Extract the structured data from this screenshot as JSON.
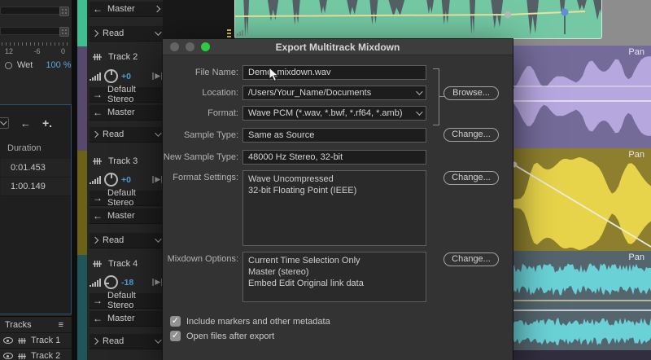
{
  "effects_rack": {
    "scale_labels": [
      "12",
      "-6",
      "0"
    ],
    "wet_label": "Wet",
    "wet_value": "100 %"
  },
  "markers_panel": {
    "back_icon_label": "←",
    "add_icon_label": "+.",
    "duration_header": "Duration",
    "rows": [
      "0:01.453",
      "1:00.149"
    ]
  },
  "tracks_panel": {
    "title": "Tracks",
    "menu_glyph": "≡",
    "items": [
      "Track 1",
      "Track 2"
    ]
  },
  "track_controls": {
    "master_label": "Master",
    "read_label": "Read",
    "tracks": [
      {
        "name": "Track 2",
        "gain": "+0",
        "input": "Default Stereo",
        "output": "Master",
        "mode": "Read",
        "color": "#57496e"
      },
      {
        "name": "Track 3",
        "gain": "+0",
        "input": "Default Stereo",
        "output": "Master",
        "mode": "Read",
        "color": "#6b6218"
      },
      {
        "name": "Track 4",
        "gain": "-18",
        "input": "Default Stereo",
        "output": "Master",
        "mode": "Read",
        "color": "#20565a"
      }
    ],
    "top_track_color": "#3fbf8f"
  },
  "timeline": {
    "pan_label": "Pan",
    "clips": {
      "teal": {
        "bg": "#74c9a4",
        "wave": "#546066"
      },
      "purple": {
        "bg": "#746b99",
        "wave": "#b7a7df"
      },
      "yellow": {
        "bg": "#8d7f2e",
        "wave": "#e8d44a"
      },
      "cyan": {
        "bg": "#54656d",
        "wave": "#6ad2d6"
      }
    },
    "envelope_yellow": "#e8e39a",
    "envelope_white": "#e9e6f4",
    "keyframe_blue": "#5f8fd8",
    "keyframe_grey": "#b9b9b9"
  },
  "dialog": {
    "title": "Export Multitrack Mixdown",
    "fields": {
      "file_name": {
        "label": "File Name:",
        "value": "Demo_mixdown.wav"
      },
      "location": {
        "label": "Location:",
        "value": "/Users/Your_Name/Documents"
      },
      "format": {
        "label": "Format:",
        "value": "Wave PCM (*.wav, *.bwf, *.rf64, *.amb)"
      },
      "sample_type": {
        "label": "Sample Type:",
        "value": "Same as Source"
      },
      "new_sample_type": {
        "label": "New Sample Type:",
        "value": "48000 Hz Stereo, 32-bit"
      },
      "format_settings": {
        "label": "Format Settings:",
        "lines": [
          "Wave Uncompressed",
          "32-bit Floating Point (IEEE)"
        ]
      },
      "mixdown_options": {
        "label": "Mixdown Options:",
        "lines": [
          "Current Time Selection Only",
          "Master (stereo)",
          "Embed Edit Original link data"
        ]
      }
    },
    "buttons": {
      "browse": "Browse...",
      "change": "Change..."
    },
    "checkboxes": [
      {
        "label": "Include markers and other metadata",
        "checked": true
      },
      {
        "label": "Open files after export",
        "checked": true
      }
    ]
  }
}
